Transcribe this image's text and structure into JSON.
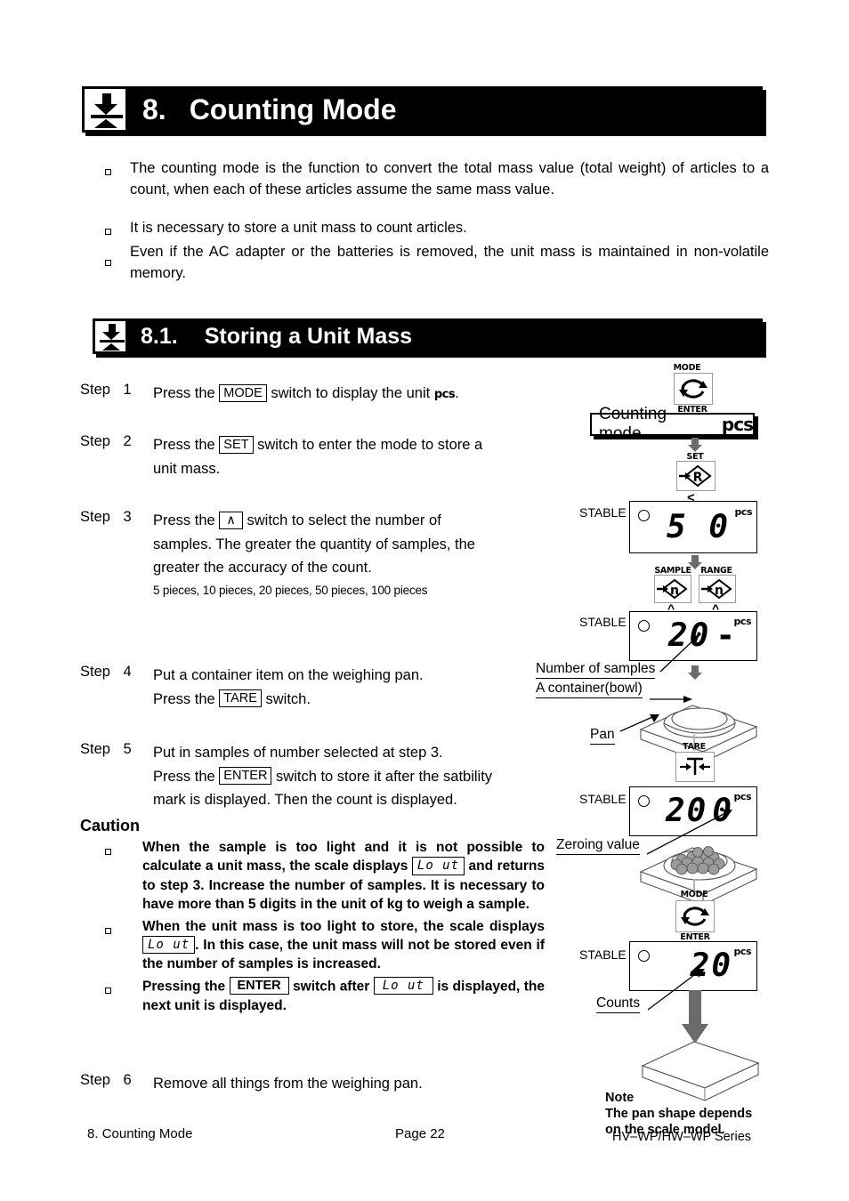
{
  "chapter": {
    "number": "8.",
    "title": "Counting Mode",
    "icon": "weigh-arrow-icon"
  },
  "intro_bullets": [
    "The counting mode is the function to convert the total mass value (total weight) of articles to a count, when each of these articles assume the same mass value.",
    "It is necessary to store a unit mass to count articles.",
    "Even if the AC adapter or the batteries is removed, the unit mass is maintained in non-volatile memory."
  ],
  "section": {
    "number": "8.1.",
    "title": "Storing a Unit Mass",
    "icon": "weigh-arrow-icon"
  },
  "steps": [
    {
      "label": "Step",
      "num": "1",
      "lines": [
        {
          "pre": "Press the ",
          "key": "MODE",
          "post": " switch to display the unit ",
          "unit": "pcs",
          "tail": "."
        }
      ]
    },
    {
      "label": "Step",
      "num": "2",
      "lines": [
        {
          "pre": "Press the ",
          "key": "SET",
          "post": " switch to enter the mode to store a"
        },
        {
          "pre": "unit mass."
        }
      ]
    },
    {
      "label": "Step",
      "num": "3",
      "lines": [
        {
          "pre": "Press the ",
          "key": "∧",
          "post": " switch to select the number of"
        },
        {
          "pre": "samples. The greater the quantity of samples, the"
        },
        {
          "pre": "greater the accuracy of the count."
        }
      ],
      "small_line": "5 pieces, 10 pieces, 20 pieces, 50 pieces, 100 pieces"
    },
    {
      "label": "Step",
      "num": "4",
      "lines": [
        {
          "pre": "Put a container item on the weighing pan."
        },
        {
          "pre": "Press the ",
          "key": "TARE",
          "post": " switch."
        }
      ]
    },
    {
      "label": "Step",
      "num": "5",
      "lines": [
        {
          "pre": "Put in samples of number selected at step 3."
        },
        {
          "pre": "Press the ",
          "key": "ENTER",
          "post": " switch to store it after the satbility"
        },
        {
          "pre": "mark is displayed. Then the count is displayed."
        }
      ]
    },
    {
      "label": "Step",
      "num": "6",
      "lines": [
        {
          "pre": "Remove all things from the weighing pan."
        }
      ]
    }
  ],
  "caution": {
    "heading": "Caution",
    "items": [
      {
        "p1": "When the sample is too light and it is not possible to calculate a unit mass, the scale displays ",
        "lcd": "Lo ut",
        "p2": " and returns to step 3. Increase the number of samples. It is necessary to have more than 5 digits in the unit of kg to weigh a sample."
      },
      {
        "p1": "When the unit mass is too light to store, the scale displays ",
        "lcd": "Lo ut",
        "p2": ". In this case, the unit mass will not be stored even if the number of samples is increased."
      },
      {
        "p1": "Pressing the ",
        "key": "ENTER",
        "p2": " switch after ",
        "lcd": "Lo ut",
        "p3": " is displayed, the next unit is displayed."
      }
    ]
  },
  "diagram": {
    "mode_button_top": {
      "cap_top": "MODE",
      "cap_bottom": "ENTER",
      "icon": "mode-cycle-icon"
    },
    "counting_mode_box": {
      "text": "Counting mode",
      "unit": "pcs"
    },
    "set_button": {
      "cap_top": "SET",
      "glyph": "→R",
      "icon": "set-diamond-r-icon"
    },
    "display_1": {
      "stable": "STABLE",
      "value": "5 0",
      "unit": "pcs"
    },
    "sample_button": {
      "cap_top": "SAMPLE",
      "glyph": "→n",
      "icon": "sample-diamond-n-icon"
    },
    "range_button": {
      "cap_top": "RANGE",
      "glyph": "→n",
      "icon": "range-diamond-n-icon"
    },
    "display_2": {
      "stable": "STABLE",
      "value": "20",
      "dash": "-",
      "unit": "pcs"
    },
    "callout_samples": "Number of samples",
    "callout_container": "A container(bowl)",
    "callout_pan": "Pan",
    "tare_button": {
      "cap_top": "TARE",
      "glyph": "→T←",
      "icon": "tare-icon"
    },
    "display_3": {
      "stable": "STABLE",
      "value": "20",
      "zero": "0",
      "unit": "pcs"
    },
    "callout_zeroing": "Zeroing value",
    "mode_button_bottom": {
      "cap_top": "MODE",
      "cap_bottom": "ENTER",
      "icon": "mode-cycle-icon"
    },
    "display_4": {
      "stable": "STABLE",
      "value": "20",
      "unit": "pcs"
    },
    "callout_counts": "Counts",
    "note": [
      "Note",
      "The pan shape depends",
      "on the scale model."
    ],
    "series": "HV–WP/HW–WP Series"
  },
  "footer": {
    "left": "8. Counting Mode",
    "center": "Page 22"
  },
  "colors": {
    "ink": "#000000",
    "paper": "#ffffff",
    "arrow_gray": "#808080",
    "bead_gray": "#9b9b9b"
  }
}
